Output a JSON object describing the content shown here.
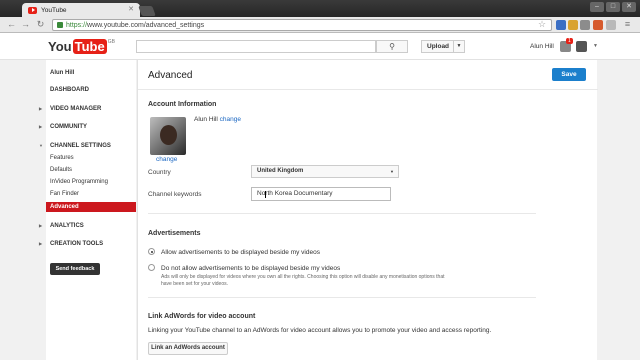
{
  "browser": {
    "tab_title": "YouTube",
    "url_scheme": "https://",
    "url_rest": "www.youtube.com/advanced_settings"
  },
  "header": {
    "logo_you": "You",
    "logo_tube": "Tube",
    "logo_region": "GB",
    "upload_label": "Upload",
    "user_name": "Alun Hill",
    "notification_count": "1"
  },
  "sidebar": {
    "user_name": "Alun Hill",
    "dashboard": "DASHBOARD",
    "video_manager": "VIDEO MANAGER",
    "community": "COMMUNITY",
    "channel_settings": "CHANNEL SETTINGS",
    "sub_items": [
      "Features",
      "Defaults",
      "InVideo Programming",
      "Fan Finder",
      "Advanced"
    ],
    "analytics": "ANALYTICS",
    "creation_tools": "CREATION TOOLS",
    "send_feedback": "Send feedback"
  },
  "main": {
    "title": "Advanced",
    "save_label": "Save",
    "account_info_heading": "Account Information",
    "account_name": "Alun Hill",
    "change_link": "change",
    "avatar_change_link": "change",
    "country_label": "Country",
    "country_value": "United Kingdom",
    "keywords_label": "Channel keywords",
    "keywords_value": "North Korea Documentary",
    "ads_heading": "Advertisements",
    "ads_allow": "Allow advertisements to be displayed beside my videos",
    "ads_disallow": "Do not allow advertisements to be displayed beside my videos",
    "ads_note": "Ads will only be displayed for videos where you own all the rights. Choosing this option will disable any monetisation options that have been set for your videos.",
    "adwords_heading": "Link AdWords for video account",
    "adwords_text": "Linking your YouTube channel to an AdWords for video account allows you to promote your video and access reporting.",
    "adwords_button": "Link an AdWords account"
  },
  "colors": {
    "brand_red": "#e62117",
    "active_red": "#cc181e",
    "save_blue": "#1b7fcc",
    "link_blue": "#1b67c2"
  }
}
